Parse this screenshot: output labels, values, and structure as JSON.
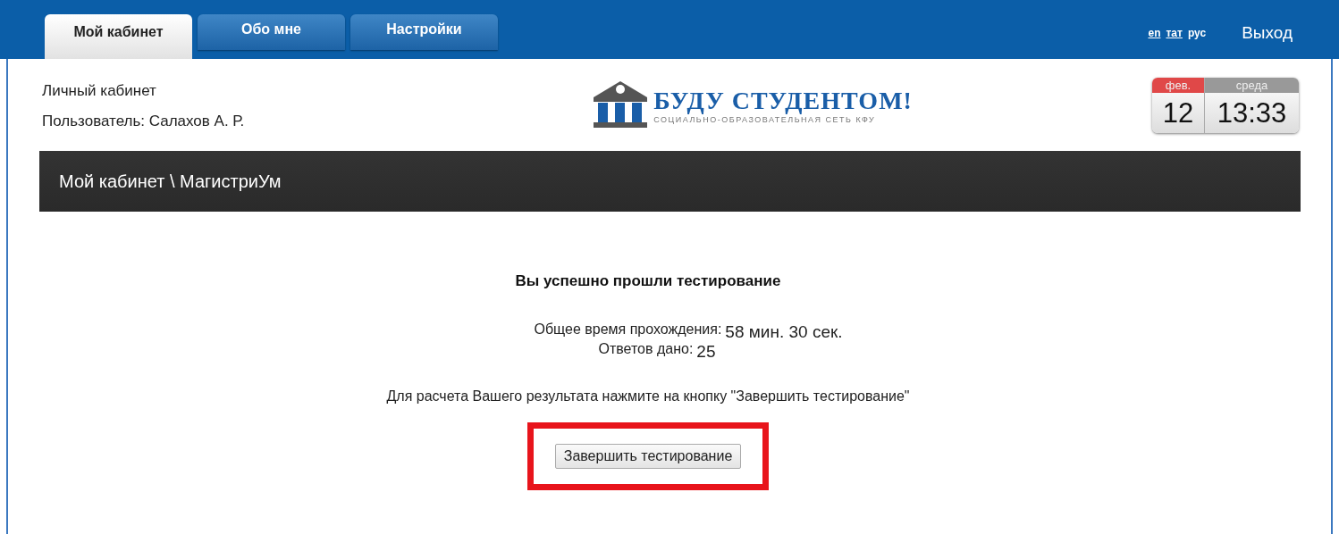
{
  "tabs": [
    {
      "label": "Мой кабинет",
      "selected": true
    },
    {
      "label": "Обо мне",
      "selected": false
    },
    {
      "label": "Настройки",
      "selected": false
    }
  ],
  "languages": [
    {
      "label": "en",
      "selected": false
    },
    {
      "label": "тат",
      "selected": false
    },
    {
      "label": "рус",
      "selected": true
    }
  ],
  "logout": "Выход",
  "user_info": {
    "title": "Личный кабинет",
    "user": "Пользователь: Салахов А. Р."
  },
  "logo": {
    "name": "БУДУ СТУДЕНТОМ!",
    "tagline": "СОЦИАЛЬНО-ОБРАЗОВАТЕЛЬНАЯ СЕТЬ КФУ"
  },
  "calendar": {
    "month": "фев.",
    "day": "12",
    "weekday": "среда",
    "time": "13:33"
  },
  "breadcrumb": "Мой кабинет \\ МагистриУм",
  "result": {
    "heading": "Вы успешно прошли тестирование",
    "stats": [
      {
        "label": "Общее время прохождения:",
        "value": "58 мин. 30 сек."
      },
      {
        "label": "Ответов дано:",
        "value": "25"
      }
    ],
    "instruction": "Для расчета Вашего результата нажмите на кнопку \"Завершить тестирование\"",
    "button": {
      "label": "Завершить тестирование",
      "highlighted": true
    }
  }
}
